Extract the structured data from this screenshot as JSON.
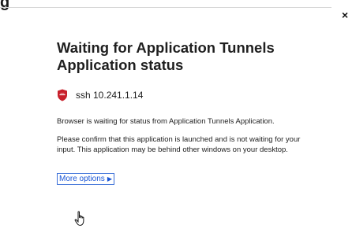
{
  "window": {
    "top_fragment_text": "g",
    "close_glyph": "×"
  },
  "dialog": {
    "title": "Waiting for Application Tunnels Application status",
    "app_name": "ssh 10.241.1.14",
    "message_1": "Browser is waiting for status from Application Tunnels Application.",
    "message_2": "Please confirm that this application is launched and is not waiting for your input. This application may be behind other windows on your desktop.",
    "more_options_label": "More options",
    "more_options_icon": "▶"
  },
  "icons": {
    "app": "shield-icon",
    "close": "close-icon",
    "cursor": "hand-cursor-icon"
  },
  "colors": {
    "shield": "#c8202b",
    "link": "#1a56d6"
  }
}
